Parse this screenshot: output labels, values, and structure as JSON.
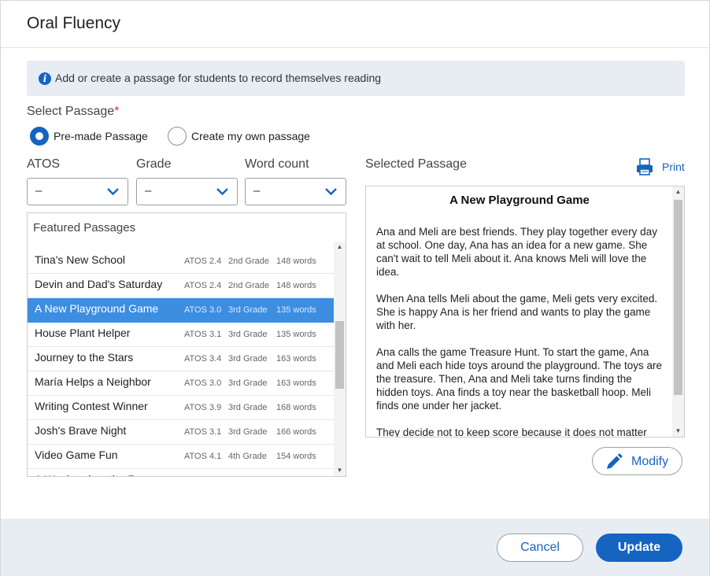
{
  "dialog": {
    "title": "Oral Fluency",
    "info_text": "Add or create a passage for students to record themselves reading",
    "info_icon": "info-icon"
  },
  "select_passage": {
    "label": "Select Passage",
    "required_mark": "*",
    "options": [
      {
        "label": "Pre-made Passage",
        "checked": true
      },
      {
        "label": "Create my own passage",
        "checked": false
      }
    ]
  },
  "filters": {
    "atos": {
      "label": "ATOS",
      "value": "–"
    },
    "grade": {
      "label": "Grade",
      "value": "–"
    },
    "word_count": {
      "label": "Word count",
      "value": "–"
    }
  },
  "passages": {
    "header": "Featured Passages",
    "rows": [
      {
        "title": "Tina's New School",
        "atos": "ATOS 2.4",
        "grade": "2nd Grade",
        "words": "148 words",
        "selected": false
      },
      {
        "title": "Devin and Dad's Saturday",
        "atos": "ATOS 2.4",
        "grade": "2nd Grade",
        "words": "148 words",
        "selected": false
      },
      {
        "title": "A New Playground Game",
        "atos": "ATOS 3.0",
        "grade": "3rd Grade",
        "words": "135 words",
        "selected": true
      },
      {
        "title": "House Plant Helper",
        "atos": "ATOS 3.1",
        "grade": "3rd Grade",
        "words": "135 words",
        "selected": false
      },
      {
        "title": "Journey to the Stars",
        "atos": "ATOS 3.4",
        "grade": "3rd Grade",
        "words": "163 words",
        "selected": false
      },
      {
        "title": "María Helps a Neighbor",
        "atos": "ATOS 3.0",
        "grade": "3rd Grade",
        "words": "163 words",
        "selected": false
      },
      {
        "title": "Writing Contest Winner",
        "atos": "ATOS 3.9",
        "grade": "3rd Grade",
        "words": "168 words",
        "selected": false
      },
      {
        "title": "Josh's Brave Night",
        "atos": "ATOS 3.1",
        "grade": "3rd Grade",
        "words": "166 words",
        "selected": false
      },
      {
        "title": "Video Game Fun",
        "atos": "ATOS 4.1",
        "grade": "4th Grade",
        "words": "154 words",
        "selected": false
      },
      {
        "title": "A Weekend on the Farm",
        "atos": "",
        "grade": "",
        "words": "",
        "selected": false
      }
    ]
  },
  "selected_passage": {
    "label": "Selected Passage",
    "print_label": "Print",
    "title": "A New Playground Game",
    "paragraphs": [
      "Ana and Meli are best friends. They play together every day at school. One day, Ana has an idea for a new game. She can't wait to tell Meli about it. Ana knows Meli will love the idea.",
      "When Ana tells Meli about the game, Meli gets very excited.  She is happy Ana is her friend and wants to play the game with her.",
      "Ana calls the game Treasure Hunt. To start the game, Ana and Meli each hide toys around the playground. The toys are the treasure. Then, Ana and Meli take turns finding the hidden toys. Ana finds a toy near the basketball hoop. Meli finds one under her jacket.",
      "They decide not to keep score because it does not matter"
    ],
    "modify_label": "Modify"
  },
  "footer": {
    "cancel_label": "Cancel",
    "update_label": "Update"
  },
  "colors": {
    "accent": "#1565c0",
    "selected_row": "#3d8ee0",
    "info_bg": "#e8edf4",
    "required": "#d32f2f"
  }
}
